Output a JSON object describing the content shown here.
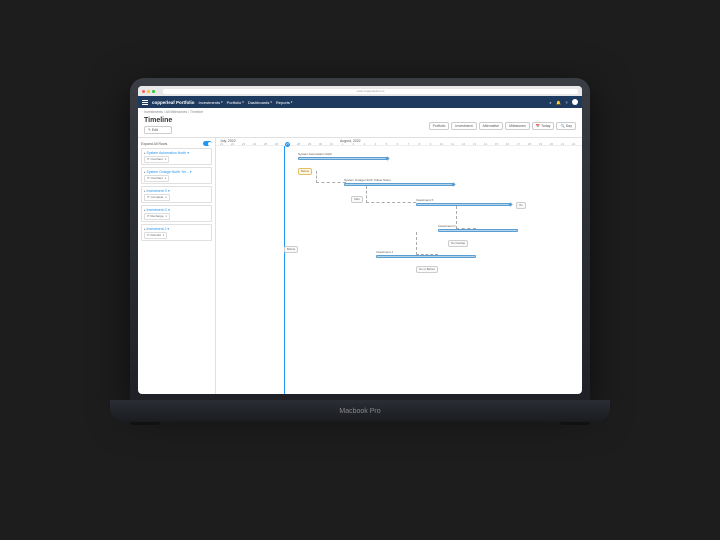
{
  "url": "www.copperleaf.com",
  "brand": "copperleaf Portfolio",
  "nav": [
    "Investments",
    "Portfolio",
    "Dashboards",
    "Reports"
  ],
  "breadcrumbs": "Investments / All Milestones / Timeline",
  "page_title": "Timeline",
  "edit_label": "✎ Edit",
  "filters": [
    "Portfolio",
    "Investment",
    "Alternative",
    "Milestones"
  ],
  "today_label": "📅 Today",
  "day_label": "🔍 Day",
  "expand_label": "Expand All Rows",
  "months": {
    "m1": "July, 2022",
    "m2": "August, 2022"
  },
  "days": [
    "21",
    "22",
    "23",
    "24",
    "25",
    "26",
    "27",
    "28",
    "29",
    "30",
    "31",
    "1",
    "2",
    "3",
    "4",
    "5",
    "6",
    "7",
    "8",
    "9",
    "10",
    "11",
    "12",
    "13",
    "14",
    "15",
    "16",
    "17",
    "18",
    "19",
    "20",
    "21",
    "22",
    "23"
  ],
  "today_day": "27",
  "investments": [
    {
      "name": "System Automation North",
      "sub": "Overhaul"
    },
    {
      "name": "System Outage North Yel...",
      "sub": "Overhaul"
    },
    {
      "name": "Investment X",
      "sub": "Complete"
    },
    {
      "name": "Investment C",
      "sub": "Recharge"
    },
    {
      "name": "Investment J",
      "sub": "Rebuild"
    }
  ],
  "gantt_labels": {
    "sys_auto": "System Automation North",
    "sys_outage": "System Outage North Yellow Stone",
    "inv_x": "Investment X",
    "inv_c": "Investment C",
    "inv_j": "Investment J",
    "before": "Before",
    "after": "After",
    "on": "On",
    "no_overlap": "No Overlap",
    "on_or_before": "On or Before"
  },
  "device_label": "Macbook Pro"
}
